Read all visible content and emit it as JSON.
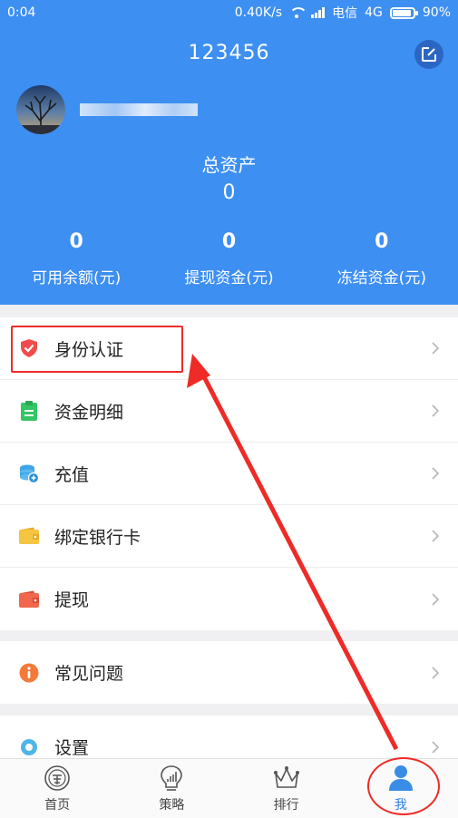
{
  "status_bar": {
    "time": "0:04",
    "speed": "0.40K/s",
    "carrier": "电信",
    "network": "4G",
    "battery_label": "90%",
    "battery_level": 0.9
  },
  "header": {
    "user_id": "123456",
    "total_assets_label": "总资产",
    "total_assets_value": "0",
    "stats": [
      {
        "value": "0",
        "label": "可用余额(元)"
      },
      {
        "value": "0",
        "label": "提现资金(元)"
      },
      {
        "value": "0",
        "label": "冻结资金(元)"
      }
    ]
  },
  "menu": {
    "items": [
      {
        "label": "身份认证",
        "icon": "shield-icon",
        "color": "#f24b4b"
      },
      {
        "label": "资金明细",
        "icon": "clipboard-icon",
        "color": "#34c565"
      },
      {
        "label": "充值",
        "icon": "coin-stack-icon",
        "color": "#3fa6e6"
      },
      {
        "label": "绑定银行卡",
        "icon": "wallet-icon",
        "color": "#f5c542"
      },
      {
        "label": "提现",
        "icon": "withdraw-wallet-icon",
        "color": "#f2674b"
      },
      {
        "label": "常见问题",
        "icon": "info-icon",
        "color": "#f27a3a"
      },
      {
        "label": "设置",
        "icon": "gear-icon",
        "color": "#4fb6e8"
      }
    ]
  },
  "tabbar": {
    "tabs": [
      {
        "label": "首页",
        "icon": "home-coin-icon"
      },
      {
        "label": "策略",
        "icon": "bulb-chart-icon"
      },
      {
        "label": "排行",
        "icon": "crown-icon"
      },
      {
        "label": "我",
        "icon": "person-icon",
        "active": true
      }
    ]
  },
  "colors": {
    "primary": "#3d8ff2",
    "annotation": "#ee2b26"
  }
}
